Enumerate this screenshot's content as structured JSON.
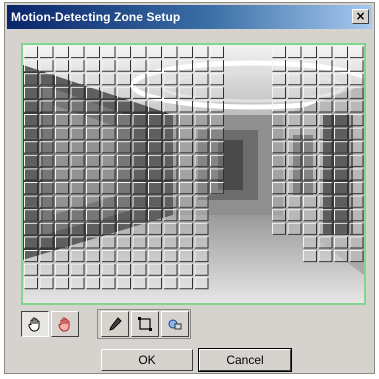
{
  "window": {
    "title": "Motion-Detecting Zone Setup",
    "close_label": "×"
  },
  "video": {
    "frame_color": "#7fd68c",
    "icon": "camera-view-corridor"
  },
  "toolbar": {
    "tools": [
      {
        "name": "hand-select-icon",
        "pressed": true
      },
      {
        "name": "hand-erase-icon",
        "pressed": false
      },
      {
        "name": "pencil-icon",
        "pressed": false
      },
      {
        "name": "rectangle-select-icon",
        "pressed": false
      },
      {
        "name": "clear-erase-icon",
        "pressed": false
      }
    ]
  },
  "buttons": {
    "ok_label": "OK",
    "cancel_label": "Cancel"
  }
}
